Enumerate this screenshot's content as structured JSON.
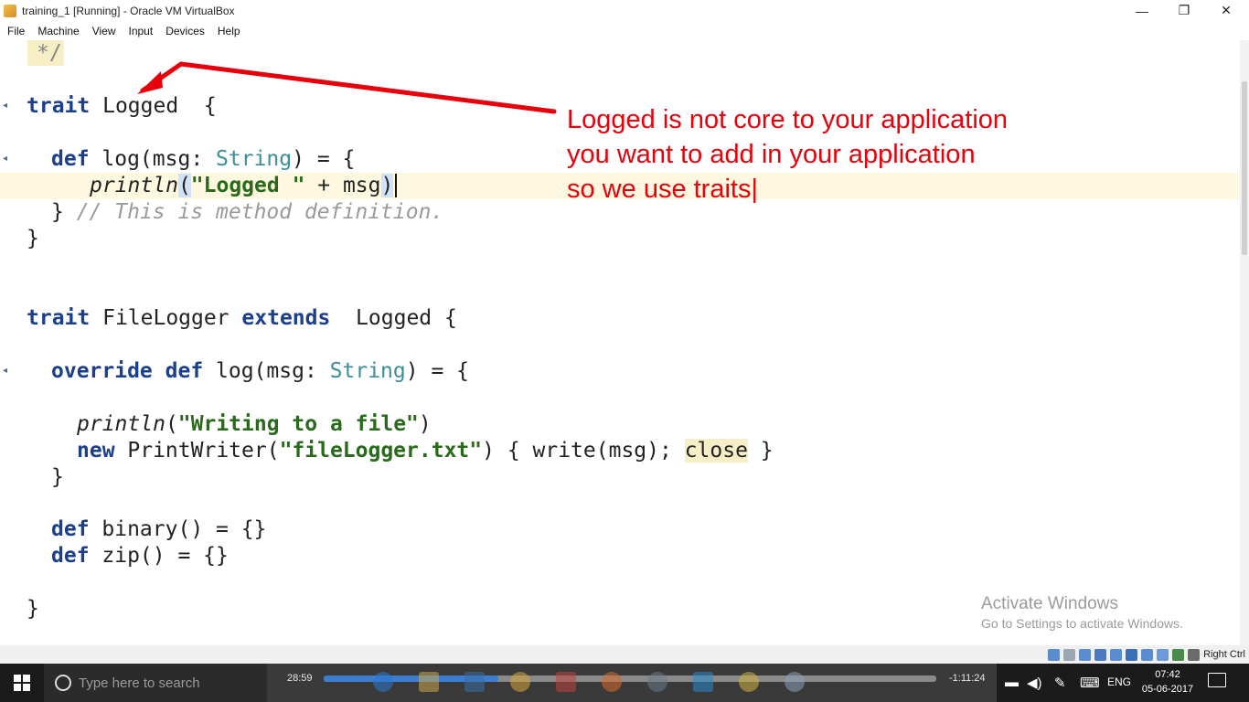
{
  "window": {
    "title": "training_1 [Running] - Oracle VM VirtualBox",
    "minimize_glyph": "—",
    "restore_glyph": "❐",
    "close_glyph": "✕"
  },
  "menu": {
    "items": [
      "File",
      "Machine",
      "View",
      "Input",
      "Devices",
      "Help"
    ]
  },
  "code": {
    "comment_close": "*/",
    "line_trait_logged": {
      "kw": "trait",
      "rest": " Logged  {"
    },
    "line_def_log": {
      "kw": "def",
      "rest1": " log(msg: ",
      "type": "String",
      "rest2": ") = {"
    },
    "line_println_logged": {
      "fn": "println",
      "open": "(",
      "str": "\"Logged \"",
      "rest": " + msg",
      "close": ")"
    },
    "line_close_comment": {
      "brace": "} ",
      "comment": "// This is method definition."
    },
    "line_close1": "}",
    "line_trait_filelogger": {
      "kw1": "trait",
      "mid": " FileLogger ",
      "kw2": "extends",
      "rest": "  Logged {"
    },
    "line_override": {
      "kw1": "override",
      "kw2": " def",
      "rest1": " log(msg: ",
      "type": "String",
      "rest2": ") = {"
    },
    "line_println_file": {
      "fn": "println",
      "open": "(",
      "str": "\"Writing to a file\"",
      "close": ")"
    },
    "line_new_printwriter": {
      "kw": "new",
      "rest1": " PrintWriter(",
      "str": "\"fileLogger.txt\"",
      "rest2": ") { write(msg); ",
      "close_kw": "close",
      "rest3": " }"
    },
    "line_close2": "}",
    "line_binary": {
      "kw": "def",
      "rest": " binary() = {}"
    },
    "line_zip": {
      "kw": "def",
      "rest": " zip() = {}"
    },
    "line_close3": "}"
  },
  "annotation": {
    "lines": [
      "Logged is not core to your application",
      "you want to add in your application",
      "so we use traits|"
    ],
    "color": "#e8000b"
  },
  "watermark": {
    "line1": "Activate Windows",
    "line2": "Go to Settings to activate Windows."
  },
  "vbox_status": {
    "host_key": "Right Ctrl"
  },
  "taskbar": {
    "search_placeholder": "Type here to search",
    "media": {
      "elapsed": "28:59",
      "remaining": "-1:11:24",
      "progress_fraction": 0.285
    },
    "tray": {
      "language": "ENG",
      "time": "07:42",
      "date": "05-06-2017"
    }
  }
}
